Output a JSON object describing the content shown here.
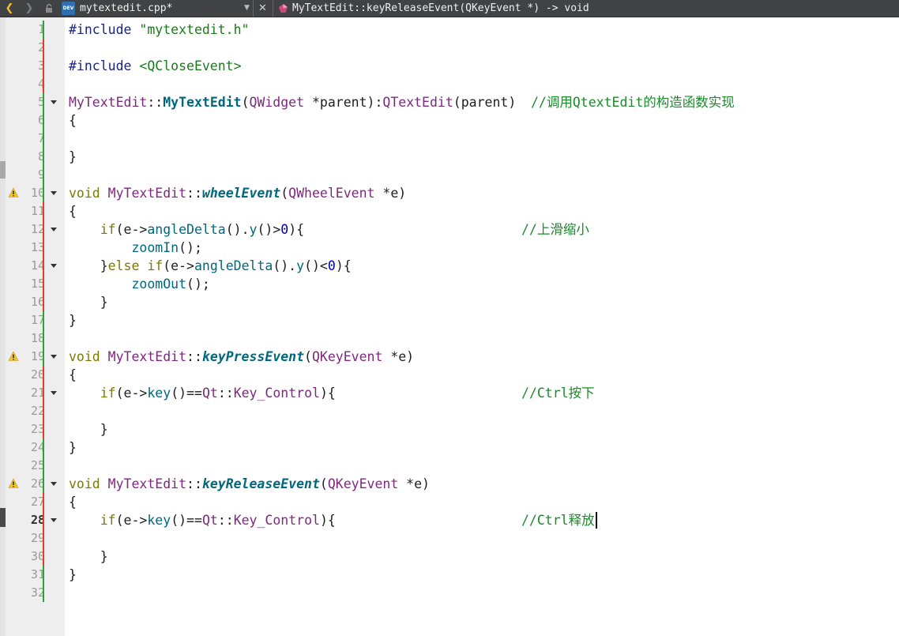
{
  "toolbar": {
    "back_glyph": "❮",
    "forward_glyph": "❯",
    "file_type_badge": "DEV",
    "file_name": "mytextedit.cpp*",
    "dropdown_glyph": "▼",
    "close_glyph": "✕",
    "symbol_name": "MyTextEdit::keyReleaseEvent(QKeyEvent *) -> void",
    "icons": [
      "chevron-left-icon",
      "chevron-right-icon",
      "lock-icon",
      "cpp-file-icon",
      "dropdown-icon",
      "close-icon",
      "method-symbol-icon"
    ]
  },
  "colors": {
    "toolbar_bg": "#404244",
    "gutter_bg": "#eeeeee",
    "modified_marker": "#e53935",
    "saved_marker": "#2e9e3e",
    "warning": "#f1c232"
  },
  "editor": {
    "current_line": 28,
    "lines": [
      {
        "n": "1",
        "warn": false,
        "fold": false,
        "change": "saved",
        "tokens": [
          [
            "pp",
            "#include "
          ],
          [
            "str",
            "\"mytextedit.h\""
          ]
        ]
      },
      {
        "n": "2",
        "warn": false,
        "fold": false,
        "change": "modified",
        "tokens": []
      },
      {
        "n": "3",
        "warn": false,
        "fold": false,
        "change": "modified",
        "tokens": [
          [
            "pp",
            "#include "
          ],
          [
            "str",
            "<QCloseEvent>"
          ]
        ]
      },
      {
        "n": "4",
        "warn": false,
        "fold": false,
        "change": "modified",
        "tokens": []
      },
      {
        "n": "5",
        "warn": false,
        "fold": true,
        "change": "saved",
        "tokens": [
          [
            "type",
            "MyTextEdit"
          ],
          [
            "p",
            "::"
          ],
          [
            "fnb",
            "MyTextEdit"
          ],
          [
            "p",
            "("
          ],
          [
            "type",
            "QWidget"
          ],
          [
            "p",
            " *parent):"
          ],
          [
            "type",
            "QTextEdit"
          ],
          [
            "p",
            "(parent)"
          ]
        ],
        "comment": "//调用QtextEdit的构造函数实现",
        "comment_col": 672
      },
      {
        "n": "6",
        "warn": false,
        "fold": false,
        "change": "saved",
        "tokens": [
          [
            "p",
            "{"
          ]
        ]
      },
      {
        "n": "7",
        "warn": false,
        "fold": false,
        "change": "saved",
        "tokens": []
      },
      {
        "n": "8",
        "warn": false,
        "fold": false,
        "change": "saved",
        "tokens": [
          [
            "p",
            "}"
          ]
        ]
      },
      {
        "n": "9",
        "warn": false,
        "fold": false,
        "change": "saved",
        "tokens": []
      },
      {
        "n": "10",
        "warn": true,
        "fold": true,
        "change": "saved",
        "tokens": [
          [
            "kw",
            "void "
          ],
          [
            "type",
            "MyTextEdit"
          ],
          [
            "p",
            "::"
          ],
          [
            "fnbi",
            "wheelEvent"
          ],
          [
            "p",
            "("
          ],
          [
            "type",
            "QWheelEvent"
          ],
          [
            "p",
            " *e)"
          ]
        ]
      },
      {
        "n": "11",
        "warn": false,
        "fold": false,
        "change": "modified",
        "tokens": [
          [
            "p",
            "{"
          ]
        ]
      },
      {
        "n": "12",
        "warn": false,
        "fold": true,
        "change": "modified",
        "tokens": [
          [
            "p",
            "    "
          ],
          [
            "kw",
            "if"
          ],
          [
            "p",
            "(e->"
          ],
          [
            "fn",
            "angleDelta"
          ],
          [
            "p",
            "()."
          ],
          [
            "fn",
            "y"
          ],
          [
            "p",
            "()>"
          ],
          [
            "num",
            "0"
          ],
          [
            "p",
            "){"
          ]
        ],
        "comment": "//上滑缩小",
        "comment_col": 660
      },
      {
        "n": "13",
        "warn": false,
        "fold": false,
        "change": "modified",
        "tokens": [
          [
            "p",
            "        "
          ],
          [
            "fn",
            "zoomIn"
          ],
          [
            "p",
            "();"
          ]
        ]
      },
      {
        "n": "14",
        "warn": false,
        "fold": true,
        "change": "modified",
        "tokens": [
          [
            "p",
            "    }"
          ],
          [
            "kw",
            "else if"
          ],
          [
            "p",
            "(e->"
          ],
          [
            "fn",
            "angleDelta"
          ],
          [
            "p",
            "()."
          ],
          [
            "fn",
            "y"
          ],
          [
            "p",
            "()<"
          ],
          [
            "num",
            "0"
          ],
          [
            "p",
            "){"
          ]
        ]
      },
      {
        "n": "15",
        "warn": false,
        "fold": false,
        "change": "modified",
        "tokens": [
          [
            "p",
            "        "
          ],
          [
            "fn",
            "zoomOut"
          ],
          [
            "p",
            "();"
          ]
        ]
      },
      {
        "n": "16",
        "warn": false,
        "fold": false,
        "change": "modified",
        "tokens": [
          [
            "p",
            "    }"
          ]
        ]
      },
      {
        "n": "17",
        "warn": false,
        "fold": false,
        "change": "saved",
        "tokens": [
          [
            "p",
            "}"
          ]
        ]
      },
      {
        "n": "18",
        "warn": false,
        "fold": false,
        "change": "saved",
        "tokens": []
      },
      {
        "n": "19",
        "warn": true,
        "fold": true,
        "change": "saved",
        "tokens": [
          [
            "kw",
            "void "
          ],
          [
            "type",
            "MyTextEdit"
          ],
          [
            "p",
            "::"
          ],
          [
            "fnbi",
            "keyPressEvent"
          ],
          [
            "p",
            "("
          ],
          [
            "type",
            "QKeyEvent"
          ],
          [
            "p",
            " *e)"
          ]
        ]
      },
      {
        "n": "20",
        "warn": false,
        "fold": false,
        "change": "modified",
        "tokens": [
          [
            "p",
            "{"
          ]
        ]
      },
      {
        "n": "21",
        "warn": false,
        "fold": true,
        "change": "modified",
        "tokens": [
          [
            "p",
            "    "
          ],
          [
            "kw",
            "if"
          ],
          [
            "p",
            "(e->"
          ],
          [
            "fn",
            "key"
          ],
          [
            "p",
            "()=="
          ],
          [
            "type",
            "Qt"
          ],
          [
            "p",
            "::"
          ],
          [
            "type",
            "Key_Control"
          ],
          [
            "p",
            "){"
          ]
        ],
        "comment": "//Ctrl按下",
        "comment_col": 660
      },
      {
        "n": "22",
        "warn": false,
        "fold": false,
        "change": "modified",
        "tokens": []
      },
      {
        "n": "23",
        "warn": false,
        "fold": false,
        "change": "modified",
        "tokens": [
          [
            "p",
            "    }"
          ]
        ]
      },
      {
        "n": "24",
        "warn": false,
        "fold": false,
        "change": "saved",
        "tokens": [
          [
            "p",
            "}"
          ]
        ]
      },
      {
        "n": "25",
        "warn": false,
        "fold": false,
        "change": "saved",
        "tokens": []
      },
      {
        "n": "26",
        "warn": true,
        "fold": true,
        "change": "saved",
        "tokens": [
          [
            "kw",
            "void "
          ],
          [
            "type",
            "MyTextEdit"
          ],
          [
            "p",
            "::"
          ],
          [
            "fnbi",
            "keyReleaseEvent"
          ],
          [
            "p",
            "("
          ],
          [
            "type",
            "QKeyEvent"
          ],
          [
            "p",
            " *e)"
          ]
        ]
      },
      {
        "n": "27",
        "warn": false,
        "fold": false,
        "change": "modified",
        "tokens": [
          [
            "p",
            "{"
          ]
        ]
      },
      {
        "n": "28",
        "warn": false,
        "fold": true,
        "change": "modified",
        "tokens": [
          [
            "p",
            "    "
          ],
          [
            "kw",
            "if"
          ],
          [
            "p",
            "(e->"
          ],
          [
            "fn",
            "key"
          ],
          [
            "p",
            "()=="
          ],
          [
            "type",
            "Qt"
          ],
          [
            "p",
            "::"
          ],
          [
            "type",
            "Key_Control"
          ],
          [
            "p",
            "){"
          ]
        ],
        "comment": "//Ctrl释放",
        "comment_col": 660
      },
      {
        "n": "29",
        "warn": false,
        "fold": false,
        "change": "modified",
        "tokens": []
      },
      {
        "n": "30",
        "warn": false,
        "fold": false,
        "change": "modified",
        "tokens": [
          [
            "p",
            "    }"
          ]
        ]
      },
      {
        "n": "31",
        "warn": false,
        "fold": false,
        "change": "saved",
        "tokens": [
          [
            "p",
            "}"
          ]
        ]
      },
      {
        "n": "32",
        "warn": false,
        "fold": false,
        "change": "saved",
        "tokens": []
      }
    ]
  }
}
